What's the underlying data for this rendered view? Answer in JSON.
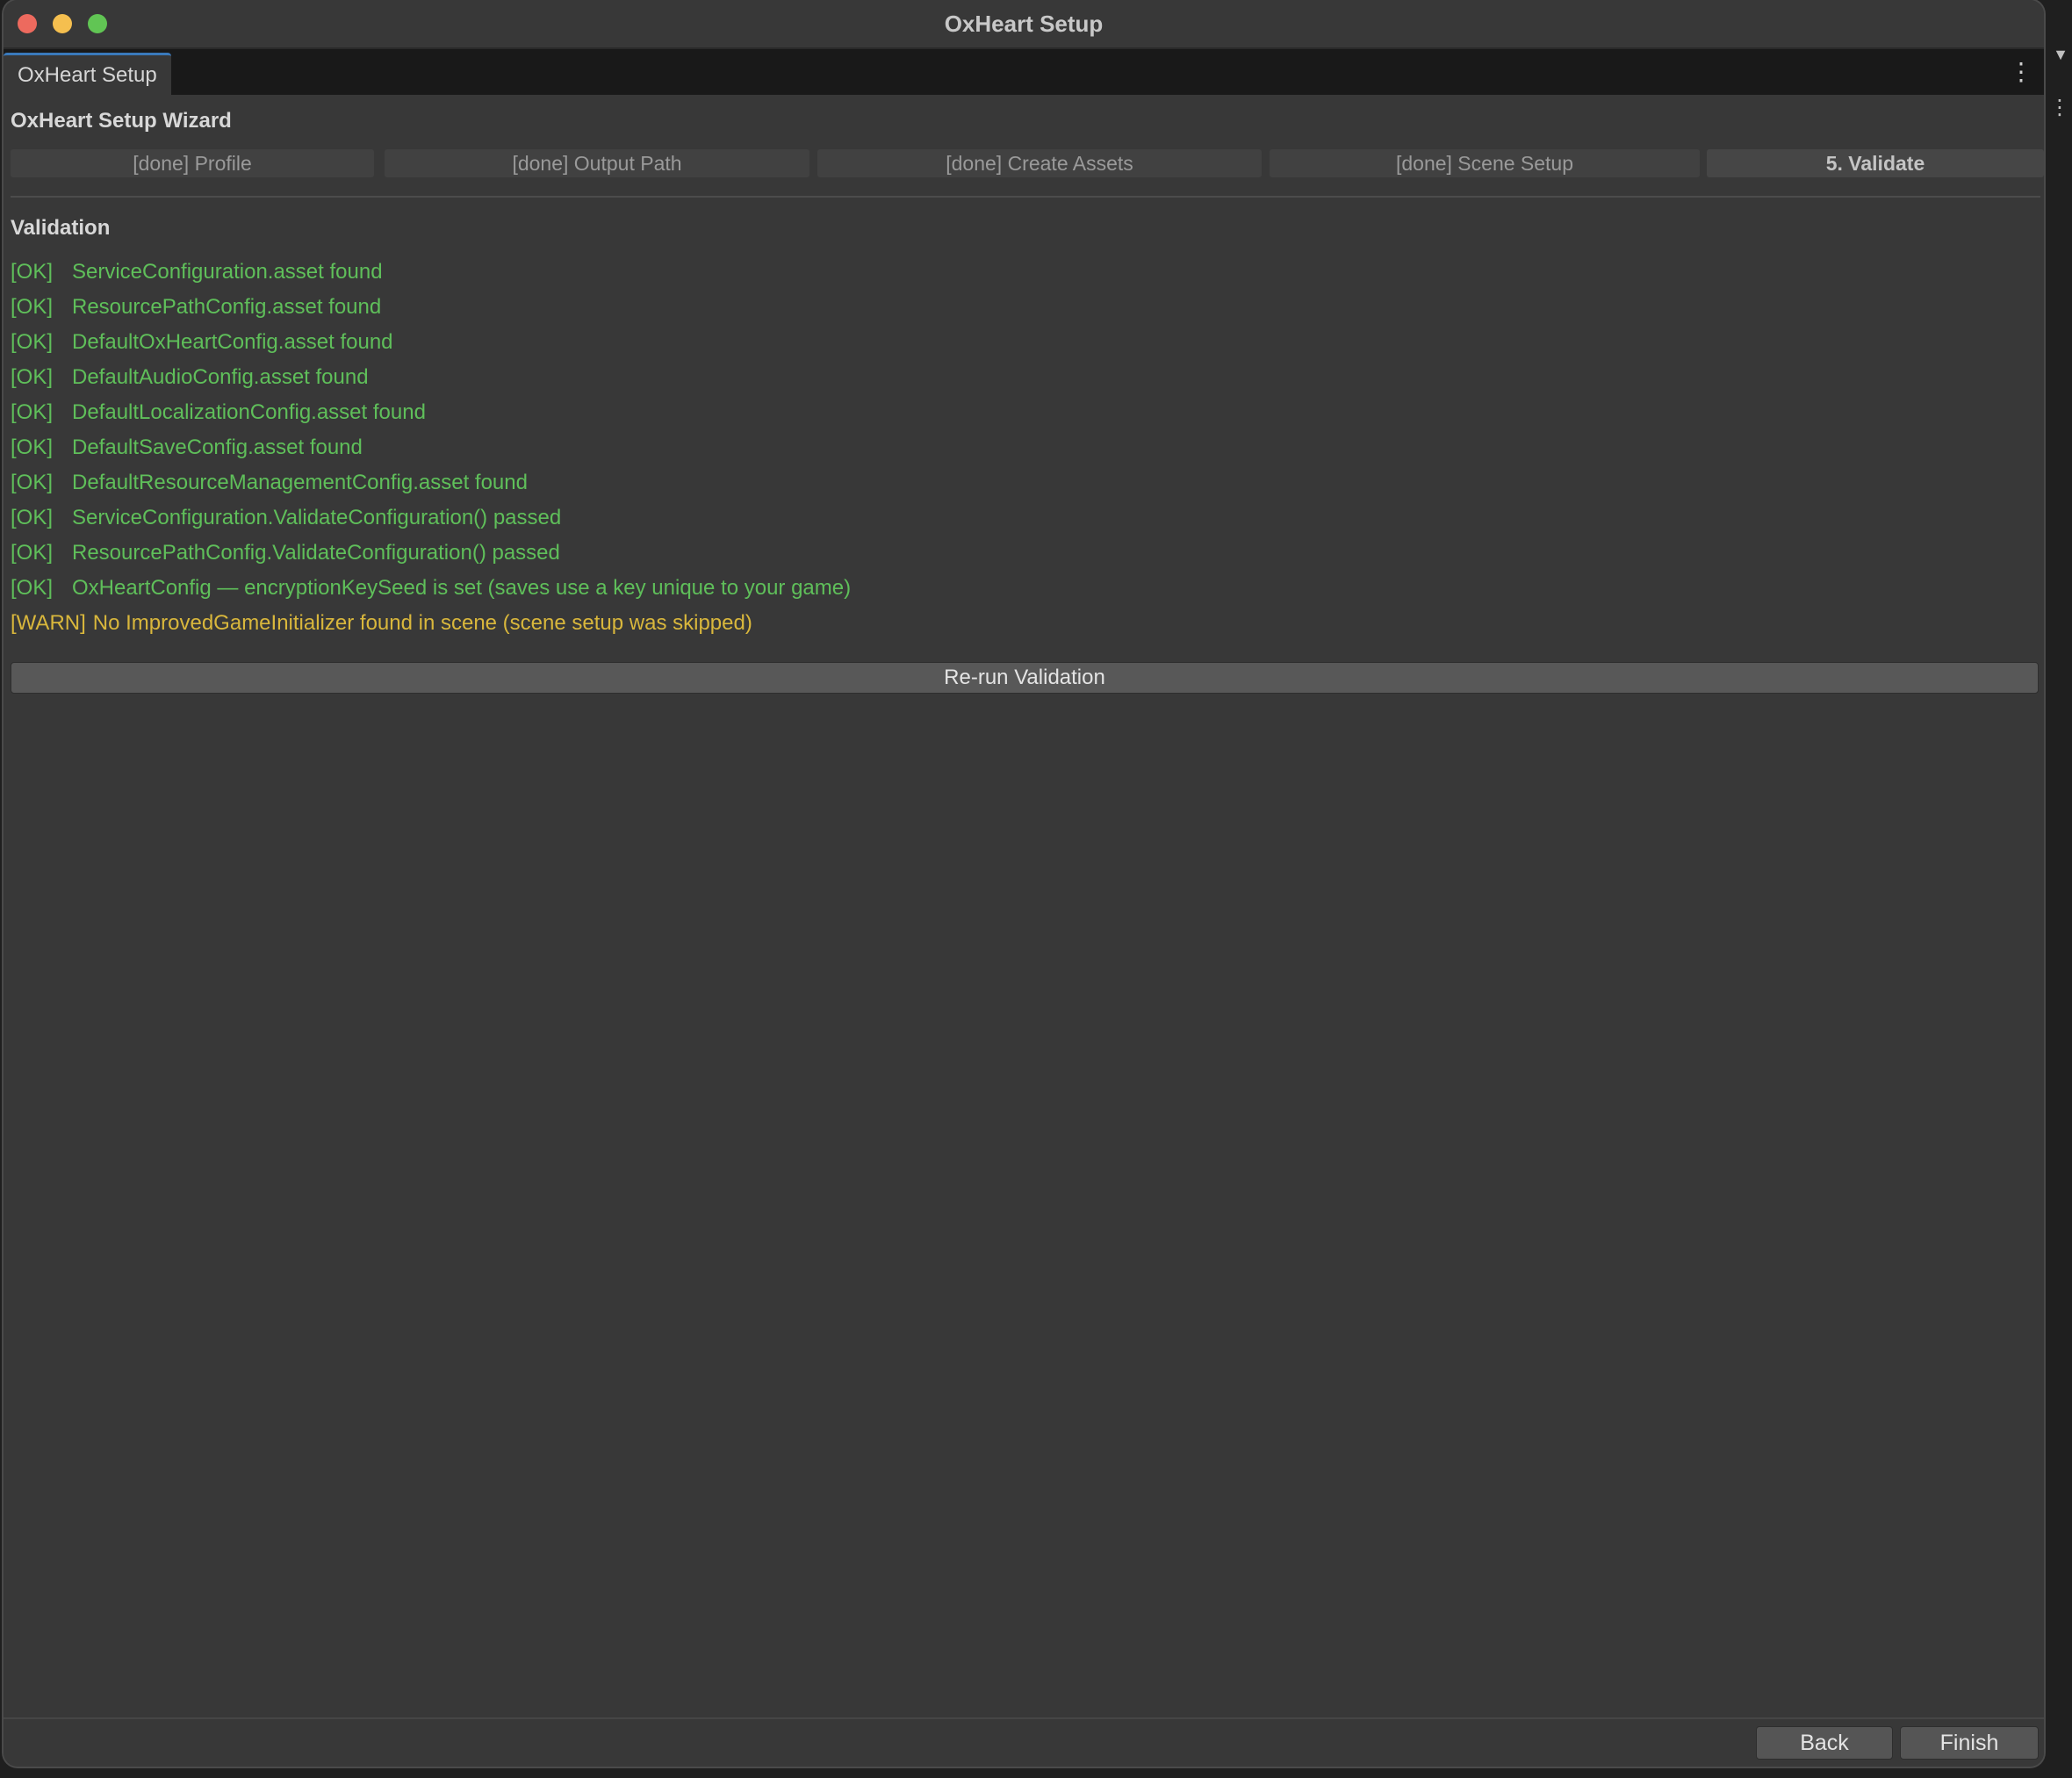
{
  "window": {
    "title": "OxHeart Setup"
  },
  "tab": {
    "label": "OxHeart Setup",
    "menu_glyph": "⋮"
  },
  "wizard": {
    "title": "OxHeart Setup Wizard",
    "steps": [
      {
        "label": "[done] Profile",
        "state": "done"
      },
      {
        "label": "[done] Output Path",
        "state": "done"
      },
      {
        "label": "[done] Create Assets",
        "state": "done"
      },
      {
        "label": "[done] Scene Setup",
        "state": "done"
      },
      {
        "label": "5. Validate",
        "state": "active"
      }
    ]
  },
  "validation": {
    "title": "Validation",
    "results": [
      {
        "status": "[OK]",
        "message": "ServiceConfiguration.asset found",
        "level": "ok"
      },
      {
        "status": "[OK]",
        "message": "ResourcePathConfig.asset found",
        "level": "ok"
      },
      {
        "status": "[OK]",
        "message": "DefaultOxHeartConfig.asset found",
        "level": "ok"
      },
      {
        "status": "[OK]",
        "message": "DefaultAudioConfig.asset found",
        "level": "ok"
      },
      {
        "status": "[OK]",
        "message": "DefaultLocalizationConfig.asset found",
        "level": "ok"
      },
      {
        "status": "[OK]",
        "message": "DefaultSaveConfig.asset found",
        "level": "ok"
      },
      {
        "status": "[OK]",
        "message": "DefaultResourceManagementConfig.asset found",
        "level": "ok"
      },
      {
        "status": "[OK]",
        "message": "ServiceConfiguration.ValidateConfiguration() passed",
        "level": "ok"
      },
      {
        "status": "[OK]",
        "message": "ResourcePathConfig.ValidateConfiguration() passed",
        "level": "ok"
      },
      {
        "status": "[OK]",
        "message": "OxHeartConfig — encryptionKeySeed is set (saves use a key unique to your game)",
        "level": "ok"
      },
      {
        "status": "[WARN]",
        "message": "No ImprovedGameInitializer found in scene (scene setup was skipped)",
        "level": "warn"
      }
    ],
    "rerun_label": "Re-run Validation"
  },
  "footer": {
    "back_label": "Back",
    "finish_label": "Finish"
  },
  "colors": {
    "ok": "#5fbf5a",
    "warn": "#d9b73c",
    "background": "#383838",
    "tab_accent": "#3a79bb"
  }
}
